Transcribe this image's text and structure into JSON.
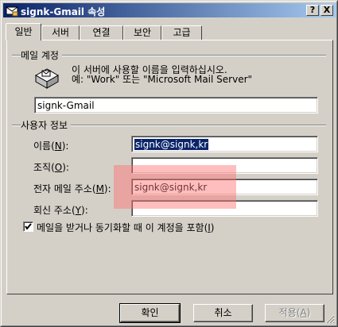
{
  "window": {
    "title": "signk-Gmail 속성",
    "help_button": "?",
    "close_button": "X"
  },
  "tabs": [
    {
      "label": "일반",
      "active": true
    },
    {
      "label": "서버",
      "active": false
    },
    {
      "label": "연결",
      "active": false
    },
    {
      "label": "보안",
      "active": false
    },
    {
      "label": "고급",
      "active": false
    }
  ],
  "mail_account": {
    "group_label": "메일 계정",
    "instruction_line1": "이 서버에 사용할 이름을 입력하십시오.",
    "instruction_line2": "예: \"Work\" 또는 \"Microsoft Mail Server\"",
    "account_name_value": "signk-Gmail"
  },
  "user_info": {
    "group_label": "사용자 정보",
    "name_label": "이름(N):",
    "name_value": "signk@signk,kr",
    "org_label": "조직(O):",
    "org_value": "",
    "email_label": "전자 메일 주소(M):",
    "email_value": "signk@signk,kr",
    "reply_label": "회신 주소(Y):",
    "reply_value": ""
  },
  "include_account": {
    "label": "메일을 받거나 동기화할 때 이 계정을 포함(I)",
    "checked": true
  },
  "buttons": {
    "ok": "확인",
    "cancel": "취소",
    "apply": "적용(A)"
  },
  "colors": {
    "face": "#d4d0c8",
    "title_start": "#0a246a",
    "title_end": "#a6caf0",
    "highlight": "#ff6e6e"
  }
}
